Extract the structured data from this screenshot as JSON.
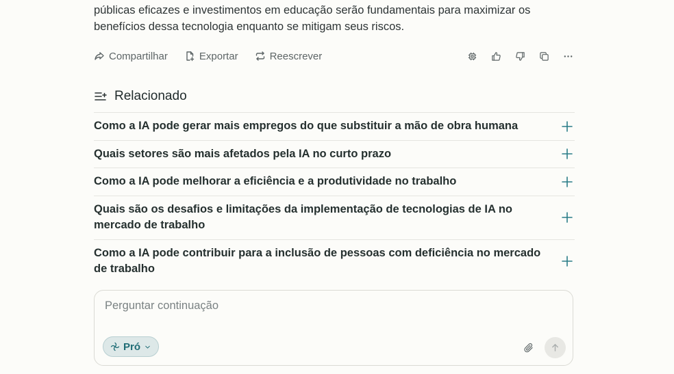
{
  "answer": {
    "text_line1": "públicas eficazes e investimentos em educação serão fundamentais para maximizar os",
    "text_line2": "benefícios dessa tecnologia enquanto se mitigam seus riscos."
  },
  "actions": {
    "share_label": "Compartilhar",
    "export_label": "Exportar",
    "rewrite_label": "Reescrever",
    "icons": [
      "chip-icon",
      "thumbs-up-icon",
      "thumbs-down-icon",
      "copy-icon",
      "more-icon"
    ]
  },
  "related": {
    "title": "Relacionado",
    "items": [
      {
        "question": "Como a IA pode gerar mais empregos do que substituir a mão de obra humana"
      },
      {
        "question": "Quais setores são mais afetados pela IA no curto prazo"
      },
      {
        "question": "Como a IA pode melhorar a eficiência e a produtividade no trabalho"
      },
      {
        "question": "Quais são os desafios e limitações da implementação de tecnologias de IA no mercado de trabalho"
      },
      {
        "question": "Como a IA pode contribuir para a inclusão de pessoas com deficiência no mercado de trabalho"
      }
    ]
  },
  "composer": {
    "placeholder": "Perguntar continuação",
    "value": "",
    "pro_label": "Pró"
  },
  "colors": {
    "accent": "#2a7d87",
    "background": "#fcfcf9",
    "divider": "#e5e5e0"
  }
}
